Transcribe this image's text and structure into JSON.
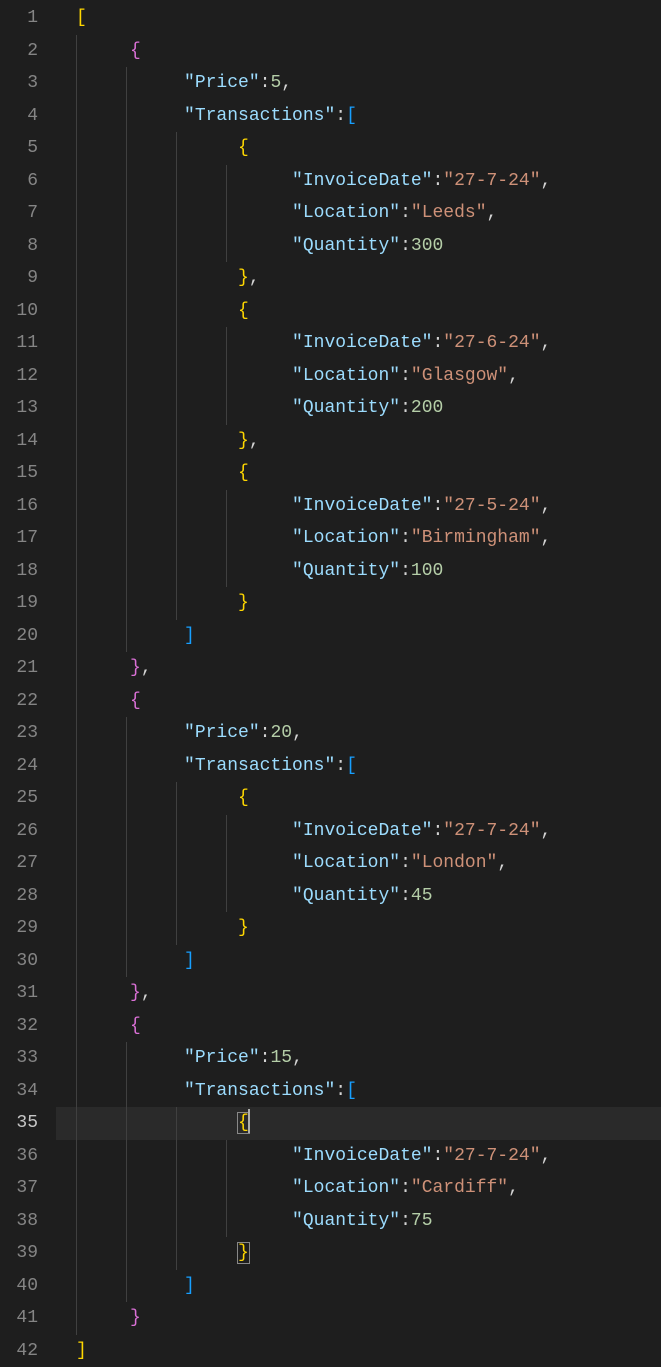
{
  "editor": {
    "activeLine": 35,
    "matchLine": 39,
    "lines": [
      {
        "n": 1,
        "indent": 0,
        "guides": [],
        "tokens": [
          [
            "brace-y",
            "["
          ]
        ]
      },
      {
        "n": 2,
        "indent": 1,
        "guides": [
          0
        ],
        "tokens": [
          [
            "brace-p",
            "{"
          ]
        ]
      },
      {
        "n": 3,
        "indent": 2,
        "guides": [
          0,
          1
        ],
        "tokens": [
          [
            "key",
            "\"Price\""
          ],
          [
            "punc",
            ":"
          ],
          [
            "num",
            "5"
          ],
          [
            "punc",
            ","
          ]
        ]
      },
      {
        "n": 4,
        "indent": 2,
        "guides": [
          0,
          1
        ],
        "tokens": [
          [
            "key",
            "\"Transactions\""
          ],
          [
            "punc",
            ":"
          ],
          [
            "brace-b",
            "["
          ]
        ]
      },
      {
        "n": 5,
        "indent": 3,
        "guides": [
          0,
          1,
          2
        ],
        "tokens": [
          [
            "brace-y",
            "{"
          ]
        ]
      },
      {
        "n": 6,
        "indent": 4,
        "guides": [
          0,
          1,
          2,
          3
        ],
        "tokens": [
          [
            "key",
            "\"InvoiceDate\""
          ],
          [
            "punc",
            ":"
          ],
          [
            "str",
            "\"27-7-24\""
          ],
          [
            "punc",
            ","
          ]
        ]
      },
      {
        "n": 7,
        "indent": 4,
        "guides": [
          0,
          1,
          2,
          3
        ],
        "tokens": [
          [
            "key",
            "\"Location\""
          ],
          [
            "punc",
            ":"
          ],
          [
            "str",
            "\"Leeds\""
          ],
          [
            "punc",
            ","
          ]
        ]
      },
      {
        "n": 8,
        "indent": 4,
        "guides": [
          0,
          1,
          2,
          3
        ],
        "tokens": [
          [
            "key",
            "\"Quantity\""
          ],
          [
            "punc",
            ":"
          ],
          [
            "num",
            "300"
          ]
        ]
      },
      {
        "n": 9,
        "indent": 3,
        "guides": [
          0,
          1,
          2
        ],
        "tokens": [
          [
            "brace-y",
            "}"
          ],
          [
            "punc",
            ","
          ]
        ]
      },
      {
        "n": 10,
        "indent": 3,
        "guides": [
          0,
          1,
          2
        ],
        "tokens": [
          [
            "brace-y",
            "{"
          ]
        ]
      },
      {
        "n": 11,
        "indent": 4,
        "guides": [
          0,
          1,
          2,
          3
        ],
        "tokens": [
          [
            "key",
            "\"InvoiceDate\""
          ],
          [
            "punc",
            ":"
          ],
          [
            "str",
            "\"27-6-24\""
          ],
          [
            "punc",
            ","
          ]
        ]
      },
      {
        "n": 12,
        "indent": 4,
        "guides": [
          0,
          1,
          2,
          3
        ],
        "tokens": [
          [
            "key",
            "\"Location\""
          ],
          [
            "punc",
            ":"
          ],
          [
            "str",
            "\"Glasgow\""
          ],
          [
            "punc",
            ","
          ]
        ]
      },
      {
        "n": 13,
        "indent": 4,
        "guides": [
          0,
          1,
          2,
          3
        ],
        "tokens": [
          [
            "key",
            "\"Quantity\""
          ],
          [
            "punc",
            ":"
          ],
          [
            "num",
            "200"
          ]
        ]
      },
      {
        "n": 14,
        "indent": 3,
        "guides": [
          0,
          1,
          2
        ],
        "tokens": [
          [
            "brace-y",
            "}"
          ],
          [
            "punc",
            ","
          ]
        ]
      },
      {
        "n": 15,
        "indent": 3,
        "guides": [
          0,
          1,
          2
        ],
        "tokens": [
          [
            "brace-y",
            "{"
          ]
        ]
      },
      {
        "n": 16,
        "indent": 4,
        "guides": [
          0,
          1,
          2,
          3
        ],
        "tokens": [
          [
            "key",
            "\"InvoiceDate\""
          ],
          [
            "punc",
            ":"
          ],
          [
            "str",
            "\"27-5-24\""
          ],
          [
            "punc",
            ","
          ]
        ]
      },
      {
        "n": 17,
        "indent": 4,
        "guides": [
          0,
          1,
          2,
          3
        ],
        "tokens": [
          [
            "key",
            "\"Location\""
          ],
          [
            "punc",
            ":"
          ],
          [
            "str",
            "\"Birmingham\""
          ],
          [
            "punc",
            ","
          ]
        ]
      },
      {
        "n": 18,
        "indent": 4,
        "guides": [
          0,
          1,
          2,
          3
        ],
        "tokens": [
          [
            "key",
            "\"Quantity\""
          ],
          [
            "punc",
            ":"
          ],
          [
            "num",
            "100"
          ]
        ]
      },
      {
        "n": 19,
        "indent": 3,
        "guides": [
          0,
          1,
          2
        ],
        "tokens": [
          [
            "brace-y",
            "}"
          ]
        ]
      },
      {
        "n": 20,
        "indent": 2,
        "guides": [
          0,
          1
        ],
        "tokens": [
          [
            "brace-b",
            "]"
          ]
        ]
      },
      {
        "n": 21,
        "indent": 1,
        "guides": [
          0
        ],
        "tokens": [
          [
            "brace-p",
            "}"
          ],
          [
            "punc",
            ","
          ]
        ]
      },
      {
        "n": 22,
        "indent": 1,
        "guides": [
          0
        ],
        "tokens": [
          [
            "brace-p",
            "{"
          ]
        ]
      },
      {
        "n": 23,
        "indent": 2,
        "guides": [
          0,
          1
        ],
        "tokens": [
          [
            "key",
            "\"Price\""
          ],
          [
            "punc",
            ":"
          ],
          [
            "num",
            "20"
          ],
          [
            "punc",
            ","
          ]
        ]
      },
      {
        "n": 24,
        "indent": 2,
        "guides": [
          0,
          1
        ],
        "tokens": [
          [
            "key",
            "\"Transactions\""
          ],
          [
            "punc",
            ":"
          ],
          [
            "brace-b",
            "["
          ]
        ]
      },
      {
        "n": 25,
        "indent": 3,
        "guides": [
          0,
          1,
          2
        ],
        "tokens": [
          [
            "brace-y",
            "{"
          ]
        ]
      },
      {
        "n": 26,
        "indent": 4,
        "guides": [
          0,
          1,
          2,
          3
        ],
        "tokens": [
          [
            "key",
            "\"InvoiceDate\""
          ],
          [
            "punc",
            ":"
          ],
          [
            "str",
            "\"27-7-24\""
          ],
          [
            "punc",
            ","
          ]
        ]
      },
      {
        "n": 27,
        "indent": 4,
        "guides": [
          0,
          1,
          2,
          3
        ],
        "tokens": [
          [
            "key",
            "\"Location\""
          ],
          [
            "punc",
            ":"
          ],
          [
            "str",
            "\"London\""
          ],
          [
            "punc",
            ","
          ]
        ]
      },
      {
        "n": 28,
        "indent": 4,
        "guides": [
          0,
          1,
          2,
          3
        ],
        "tokens": [
          [
            "key",
            "\"Quantity\""
          ],
          [
            "punc",
            ":"
          ],
          [
            "num",
            "45"
          ]
        ]
      },
      {
        "n": 29,
        "indent": 3,
        "guides": [
          0,
          1,
          2
        ],
        "tokens": [
          [
            "brace-y",
            "}"
          ]
        ]
      },
      {
        "n": 30,
        "indent": 2,
        "guides": [
          0,
          1
        ],
        "tokens": [
          [
            "brace-b",
            "]"
          ]
        ]
      },
      {
        "n": 31,
        "indent": 1,
        "guides": [
          0
        ],
        "tokens": [
          [
            "brace-p",
            "}"
          ],
          [
            "punc",
            ","
          ]
        ]
      },
      {
        "n": 32,
        "indent": 1,
        "guides": [
          0
        ],
        "tokens": [
          [
            "brace-p",
            "{"
          ]
        ]
      },
      {
        "n": 33,
        "indent": 2,
        "guides": [
          0,
          1
        ],
        "tokens": [
          [
            "key",
            "\"Price\""
          ],
          [
            "punc",
            ":"
          ],
          [
            "num",
            "15"
          ],
          [
            "punc",
            ","
          ]
        ]
      },
      {
        "n": 34,
        "indent": 2,
        "guides": [
          0,
          1
        ],
        "tokens": [
          [
            "key",
            "\"Transactions\""
          ],
          [
            "punc",
            ":"
          ],
          [
            "brace-b",
            "["
          ]
        ]
      },
      {
        "n": 35,
        "indent": 3,
        "guides": [
          0,
          1,
          2
        ],
        "tokens": [
          [
            "brace-y",
            "{"
          ]
        ],
        "cursorAfter": true,
        "matchOpen": true
      },
      {
        "n": 36,
        "indent": 4,
        "guides": [
          0,
          1,
          2,
          3
        ],
        "tokens": [
          [
            "key",
            "\"InvoiceDate\""
          ],
          [
            "punc",
            ":"
          ],
          [
            "str",
            "\"27-7-24\""
          ],
          [
            "punc",
            ","
          ]
        ]
      },
      {
        "n": 37,
        "indent": 4,
        "guides": [
          0,
          1,
          2,
          3
        ],
        "tokens": [
          [
            "key",
            "\"Location\""
          ],
          [
            "punc",
            ":"
          ],
          [
            "str",
            "\"Cardiff\""
          ],
          [
            "punc",
            ","
          ]
        ]
      },
      {
        "n": 38,
        "indent": 4,
        "guides": [
          0,
          1,
          2,
          3
        ],
        "tokens": [
          [
            "key",
            "\"Quantity\""
          ],
          [
            "punc",
            ":"
          ],
          [
            "num",
            "75"
          ]
        ]
      },
      {
        "n": 39,
        "indent": 3,
        "guides": [
          0,
          1,
          2
        ],
        "tokens": [
          [
            "brace-y",
            "}"
          ]
        ],
        "matchClose": true
      },
      {
        "n": 40,
        "indent": 2,
        "guides": [
          0,
          1
        ],
        "tokens": [
          [
            "brace-b",
            "]"
          ]
        ]
      },
      {
        "n": 41,
        "indent": 1,
        "guides": [
          0
        ],
        "tokens": [
          [
            "brace-p",
            "}"
          ]
        ]
      },
      {
        "n": 42,
        "indent": 0,
        "guides": [],
        "tokens": [
          [
            "brace-y",
            "]"
          ]
        ]
      }
    ]
  }
}
